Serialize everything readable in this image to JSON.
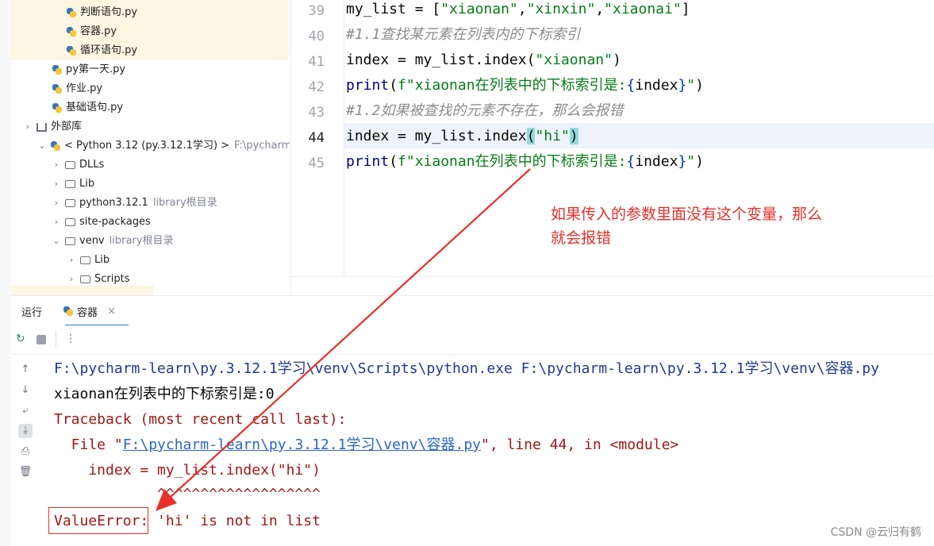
{
  "project_tree": {
    "items": [
      {
        "label": "判断语句.py",
        "extra": ""
      },
      {
        "label": "容器.py",
        "extra": ""
      },
      {
        "label": "循环语句.py",
        "extra": ""
      },
      {
        "label": "py第一天.py",
        "extra": ""
      },
      {
        "label": "作业.py",
        "extra": ""
      },
      {
        "label": "基础语句.py",
        "extra": ""
      },
      {
        "label": "外部库",
        "extra": ""
      },
      {
        "label": "< Python 3.12 (py.3.12.1学习) >",
        "extra": "F:\\pycharm-l"
      },
      {
        "label": "DLLs",
        "extra": ""
      },
      {
        "label": "Lib",
        "extra": ""
      },
      {
        "label": "python3.12.1",
        "extra": "library根目录"
      },
      {
        "label": "site-packages",
        "extra": ""
      },
      {
        "label": "venv",
        "extra": "library根目录"
      },
      {
        "label": "Lib",
        "extra": ""
      },
      {
        "label": "Scripts",
        "extra": ""
      }
    ]
  },
  "editor": {
    "line_numbers": [
      "39",
      "40",
      "41",
      "42",
      "43",
      "44",
      "45"
    ],
    "code": {
      "l39_a": "my_list = [",
      "l39_s1": "\"xiaonan\"",
      "l39_c1": ",",
      "l39_s2": "\"xinxin\"",
      "l39_c2": ",",
      "l39_s3": "\"xiaonai\"",
      "l39_b": "]",
      "l40": "#1.1查找某元素在列表内的下标索引",
      "l41_a": "index = my_list.index(",
      "l41_s": "\"xiaonan\"",
      "l41_b": ")",
      "l42_fn": "print",
      "l42_a": "(",
      "l42_s1": "f\"xiaonan在列表中的下标索引是:",
      "l42_o": "{",
      "l42_v": "index",
      "l42_c": "}",
      "l42_s2": "\"",
      "l42_b": ")",
      "l43": "#1.2如果被查找的元素不存在，那么会报错",
      "l44_a": "index = my_list.index",
      "l44_p1": "(",
      "l44_s": "\"hi\"",
      "l44_p2": ")",
      "l45_fn": "print",
      "l45_a": "(",
      "l45_s1": "f\"xiaonan在列表中的下标索引是:",
      "l45_o": "{",
      "l45_v": "index",
      "l45_c": "}",
      "l45_s2": "\"",
      "l45_b": ")"
    }
  },
  "annotation": {
    "line1": "如果传入的参数里面没有这个变量，那么",
    "line2": "就会报错"
  },
  "run_panel": {
    "label": "运行",
    "tab_label": "容器",
    "tab_close": "×"
  },
  "console": {
    "cmd_line": "F:\\pycharm-learn\\py.3.12.1学习\\venv\\Scripts\\python.exe F:\\pycharm-learn\\py.3.12.1学习\\venv\\容器.py",
    "out1": "xiaonan在列表中的下标索引是:0",
    "traceback": "Traceback (most recent call last):",
    "file_prefix": "  File \"",
    "file_link": "F:\\pycharm-learn\\py.3.12.1学习\\venv\\容器.py",
    "file_suffix": "\", line 44, in <module>",
    "src_line": "    index = my_list.index(\"hi\")",
    "carets": "            ^^^^^^^^^^^^^^^^^^^",
    "error_type": "ValueError:",
    "error_msg": " 'hi' is not in list"
  },
  "watermark": "CSDN @云归有鹤",
  "colors": {
    "annotation_red": "#e8302a",
    "console_red": "#a31515",
    "link_blue": "#2a66c8"
  }
}
